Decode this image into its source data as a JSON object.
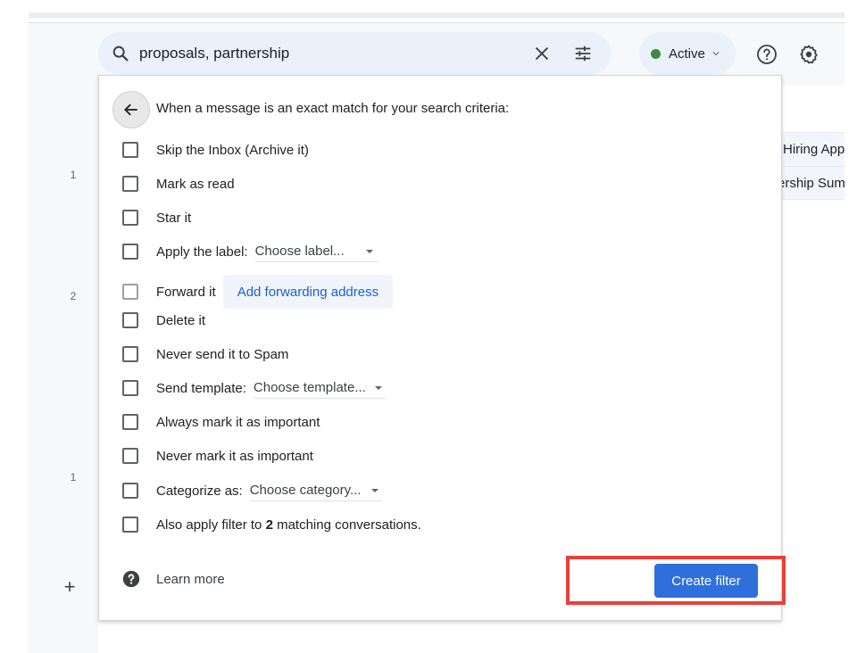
{
  "search": {
    "query": "proposals, partnership",
    "icon": "search-icon",
    "clear_icon": "close-icon",
    "options_icon": "tune-icon"
  },
  "status": {
    "label": "Active",
    "color": "#3c8c3e"
  },
  "header_icons": [
    "help-icon",
    "gear-icon"
  ],
  "left_rail": {
    "counts": [
      "1",
      "2",
      "1"
    ],
    "add_icon": "plus-icon"
  },
  "background_mail": {
    "rows": [
      "Hiring App",
      "ership Sum"
    ]
  },
  "filter_panel": {
    "heading": "When a message is an exact match for your search criteria:",
    "back_icon": "arrow-back-icon",
    "options": [
      {
        "label": "Skip the Inbox (Archive it)",
        "checked": false
      },
      {
        "label": "Mark as read",
        "checked": false
      },
      {
        "label": "Star it",
        "checked": false
      },
      {
        "label": "Apply the label:",
        "checked": false,
        "select": "Choose label..."
      },
      {
        "label": "Forward it",
        "checked": false,
        "disabled": true,
        "button": "Add forwarding address"
      },
      {
        "label": "Delete it",
        "checked": false
      },
      {
        "label": "Never send it to Spam",
        "checked": false
      },
      {
        "label": "Send template:",
        "checked": false,
        "select": "Choose template..."
      },
      {
        "label": "Always mark it as important",
        "checked": false
      },
      {
        "label": "Never mark it as important",
        "checked": false
      },
      {
        "label": "Categorize as:",
        "checked": false,
        "select": "Choose category..."
      },
      {
        "label_pre": "Also apply filter to ",
        "label_bold": "2",
        "label_post": " matching conversations.",
        "checked": false
      }
    ],
    "learn_more": "Learn more",
    "create_button": "Create filter",
    "accent_color": "#2f6fdc",
    "highlight_color": "#e8413a"
  }
}
